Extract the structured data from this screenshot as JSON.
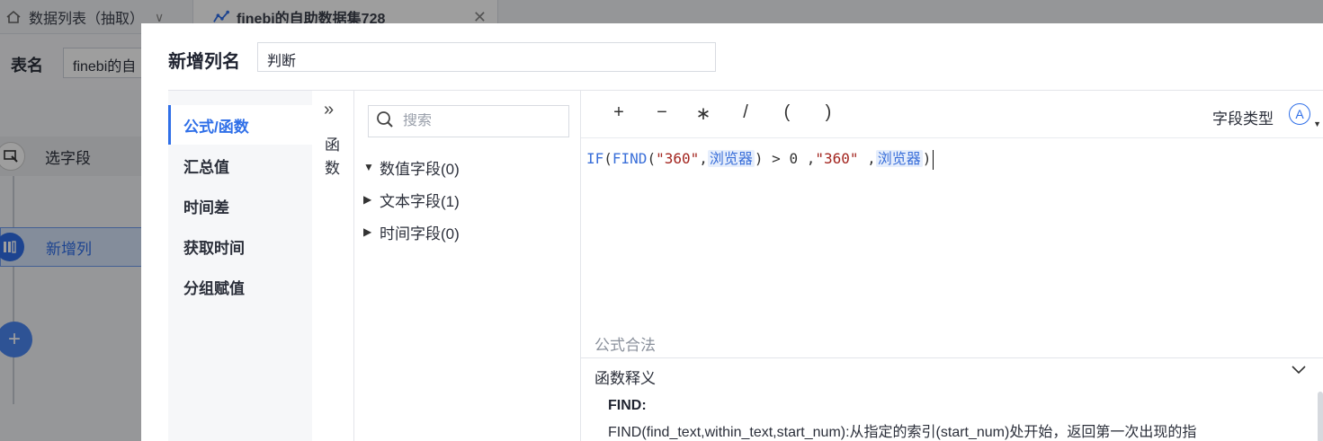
{
  "tabs": [
    {
      "label": "数据列表（抽取）",
      "icon": "home-icon"
    },
    {
      "label": "finebi的自助数据集728",
      "icon": "dataset-chart-icon"
    }
  ],
  "background": {
    "table_label": "表名",
    "table_value": "finebi的自",
    "steps": [
      {
        "label": "选字段",
        "icon": "select-field-icon"
      },
      {
        "label": "新增列",
        "icon": "add-column-icon"
      }
    ]
  },
  "dialog": {
    "title": "新增列名",
    "column_name": "判断",
    "categories": [
      "公式/函数",
      "汇总值",
      "时间差",
      "获取时间",
      "分组赋值"
    ],
    "collapse_label_1": "函",
    "collapse_label_2": "数",
    "search_placeholder": "搜索",
    "field_groups": [
      "数值字段(0)",
      "文本字段(1)",
      "时间字段(0)"
    ],
    "operators": [
      "+",
      "−",
      "∗",
      "/",
      "(",
      ")"
    ],
    "field_type_label": "字段类型",
    "formula": {
      "if": "IF",
      "p1": "(",
      "find": "FIND",
      "p2": "(",
      "s1": "\"360\"",
      "c1": ",",
      "f1": "浏览器",
      "gt": ") > 0 ,",
      "s2": "\"360\"",
      "c2": " ,",
      "f2": "浏览器",
      "p3": ")"
    },
    "validation": "公式合法",
    "explain_title": "函数释义",
    "explain_fn": "FIND:",
    "explain_desc": "FIND(find_text,within_text,start_num):从指定的索引(start_num)处开始，返回第一次出现的指"
  }
}
